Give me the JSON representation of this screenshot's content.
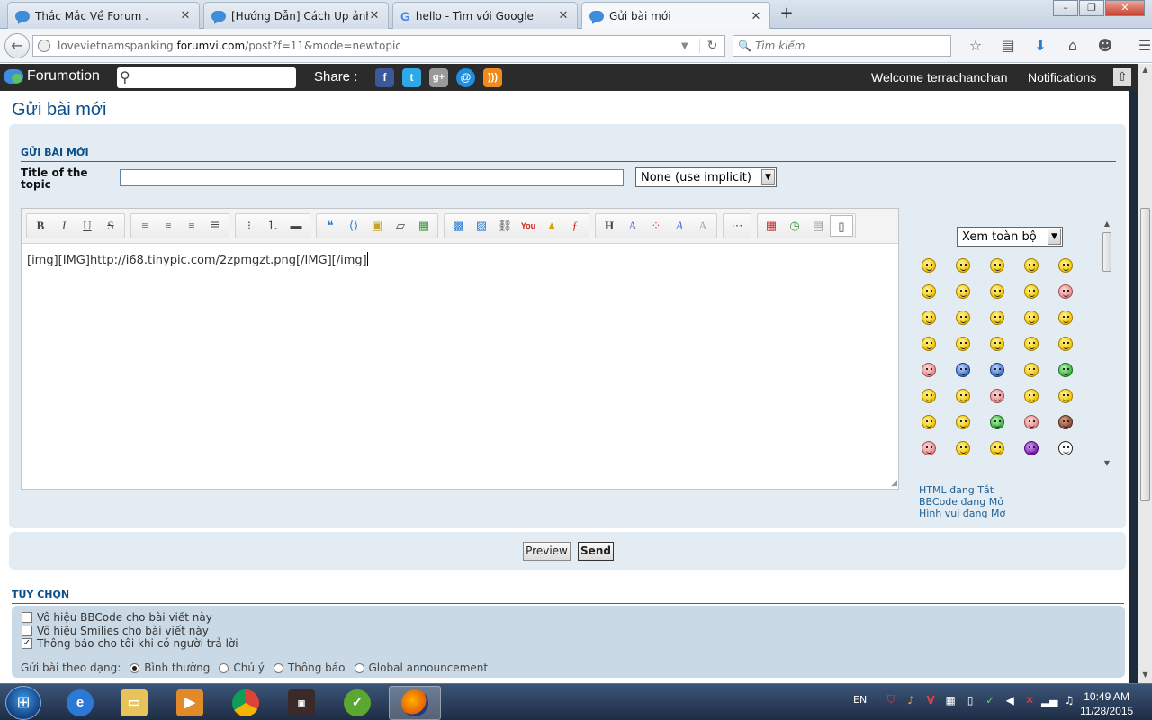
{
  "browser": {
    "tabs": [
      {
        "title": "Thắc Mắc Về Forum .",
        "icon": "forumotion-bubble-icon"
      },
      {
        "title": "[Hướng Dẫn] Cách Up ảnh ...",
        "icon": "forumotion-bubble-icon"
      },
      {
        "title": "hello - Tìm với Google",
        "icon": "google-icon"
      },
      {
        "title": "Gửi bài mới",
        "icon": "forumotion-bubble-icon",
        "active": true
      }
    ],
    "url_prefix": "lovevietnamspanking.",
    "url_domain": "forumvi.com",
    "url_path": "/post?f=11&mode=newtopic",
    "search_placeholder": "Tìm kiếm"
  },
  "forumotion": {
    "brand": "Forumotion",
    "share_label": "Share :",
    "welcome": "Welcome terrachanchan",
    "notifications": "Notifications",
    "social": [
      "facebook-icon",
      "twitter-icon",
      "google-plus-icon",
      "email-icon",
      "rss-icon"
    ]
  },
  "page": {
    "title": "Gửi bài mới",
    "section_heading": "GỬI BÀI MỚI",
    "topic_label": "Title of the topic",
    "topic_value": "",
    "prefix_selected": "None (use implicit)",
    "editor_content": "[img][IMG]http://i68.tinypic.com/2zpmgzt.png[/IMG][/img]",
    "smilies_select": "Xem toàn bộ",
    "status": {
      "html": "HTML đang Tắt",
      "bbcode_link": "BBCode",
      "bbcode_state": " đang Mở",
      "smilies_link": "Hình vui",
      "smilies_state": " đang Mở"
    },
    "buttons": {
      "preview": "Preview",
      "send": "Send"
    }
  },
  "options": {
    "heading": "TÙY CHỌN",
    "checkboxes": [
      {
        "label": "Vô hiệu BBCode cho bài viết này",
        "checked": false
      },
      {
        "label": "Vô hiệu Smilies cho bài viết này",
        "checked": false
      },
      {
        "label": "Thông báo cho tôi khi có người trả lời",
        "checked": true
      }
    ],
    "post_type_label": "Gửi bài theo dạng:",
    "post_types": [
      "Bình thường",
      "Chú ý",
      "Thông báo",
      "Global announcement"
    ],
    "post_type_selected": "Bình thường"
  },
  "taskbar": {
    "lang": "EN",
    "time": "10:49 AM",
    "date": "11/28/2015"
  },
  "colors": {
    "accent": "#0b4f8a",
    "panel": "#e3ecf2",
    "forumotion_bar": "#2b2b2b"
  }
}
